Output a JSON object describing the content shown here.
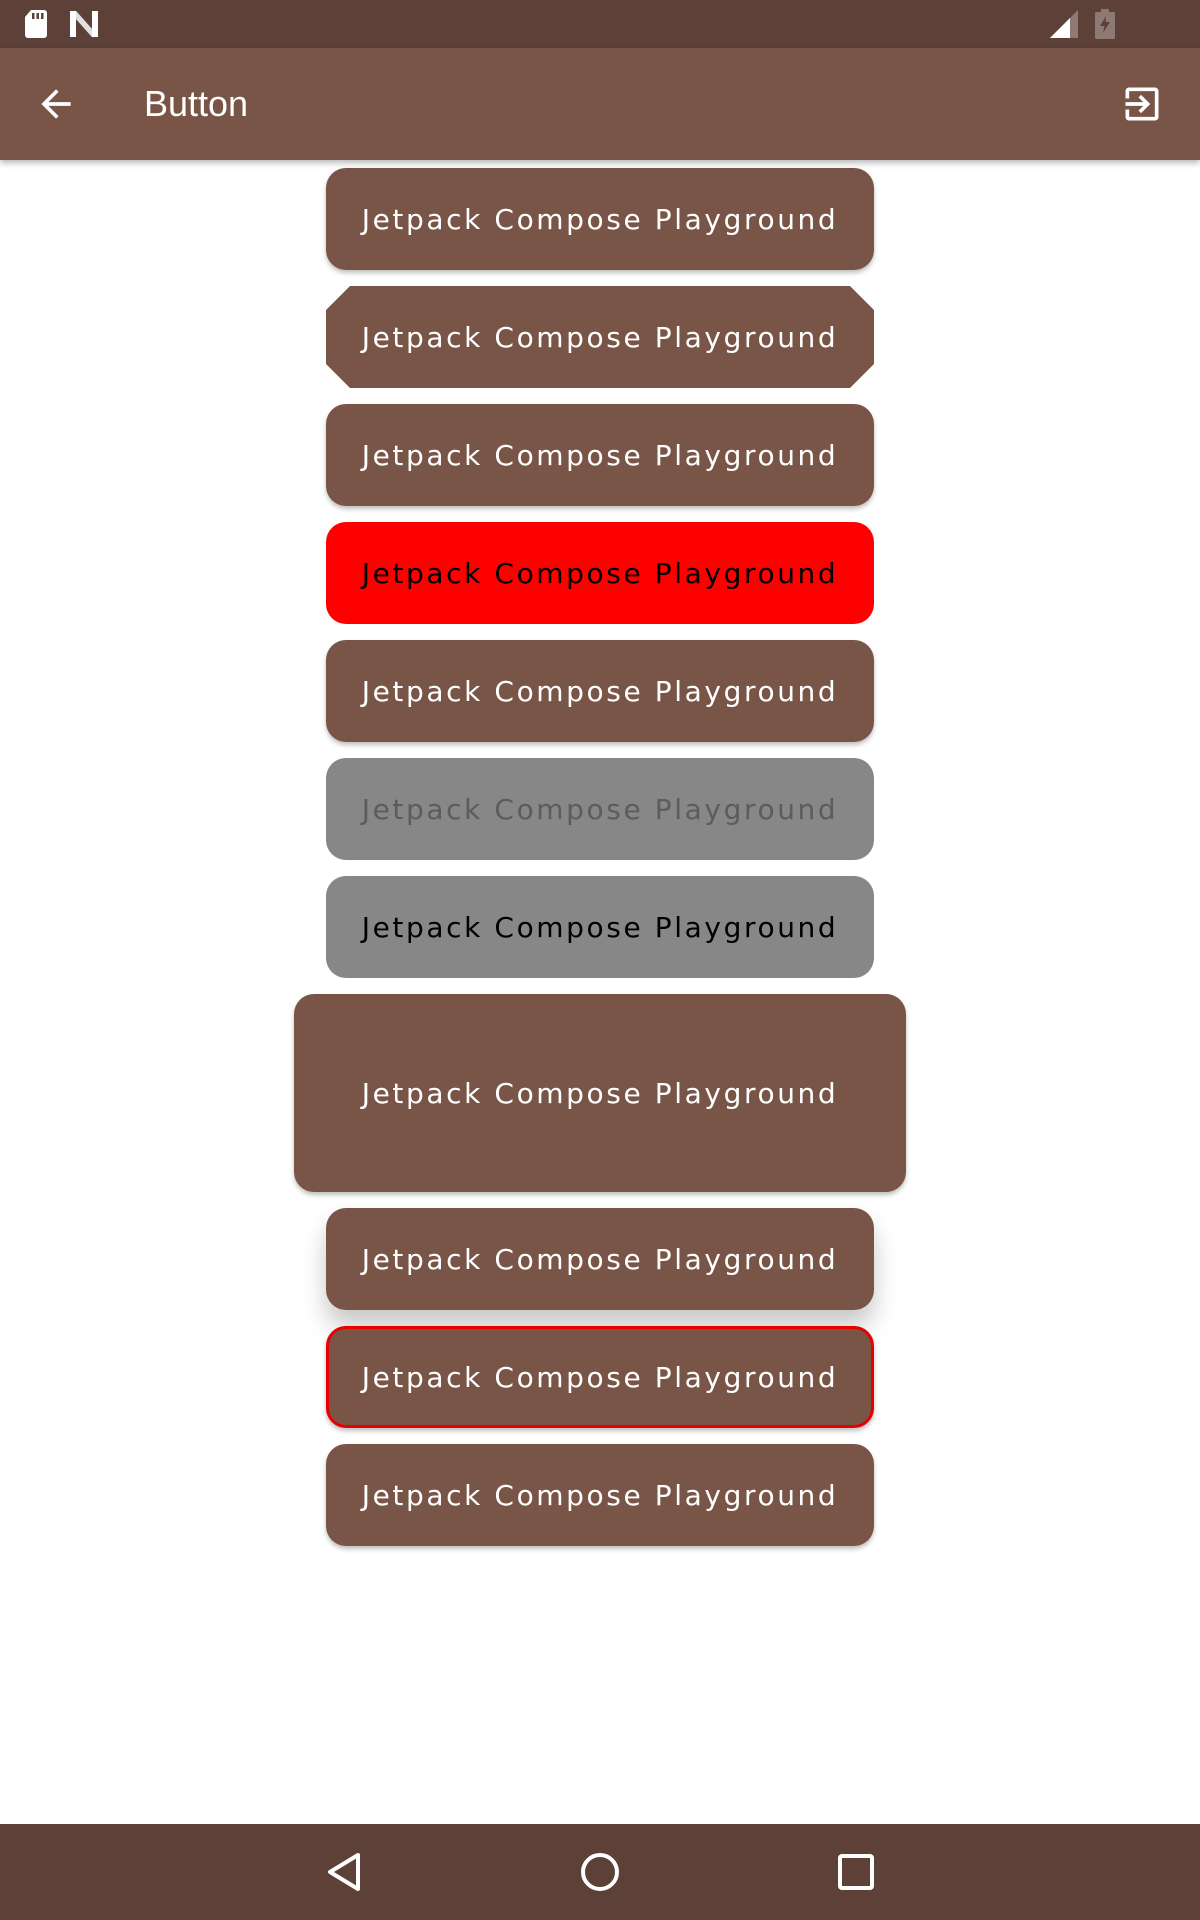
{
  "app_bar": {
    "title": "Button",
    "back_icon": "arrow-back-icon",
    "action_icon": "exit-to-app-icon"
  },
  "colors": {
    "primary": "#795548",
    "primary_dark": "#5d4037",
    "red": "#ff0000",
    "disabled_gray": "#878787"
  },
  "buttons": [
    {
      "label": "Jetpack Compose Playground",
      "style": "rounded"
    },
    {
      "label": "Jetpack Compose Playground",
      "style": "cut-corner"
    },
    {
      "label": "Jetpack Compose Playground",
      "style": "rounded"
    },
    {
      "label": "Jetpack Compose Playground",
      "style": "red-background"
    },
    {
      "label": "Jetpack Compose Playground",
      "style": "rounded"
    },
    {
      "label": "Jetpack Compose Playground",
      "style": "disabled"
    },
    {
      "label": "Jetpack Compose Playground",
      "style": "gray-background"
    },
    {
      "label": "Jetpack Compose Playground",
      "style": "large-padding"
    },
    {
      "label": "Jetpack Compose Playground",
      "style": "elevated"
    },
    {
      "label": "Jetpack Compose Playground",
      "style": "red-border"
    },
    {
      "label": "Jetpack Compose Playground",
      "style": "rounded"
    }
  ],
  "status_bar": {
    "icons": [
      "sd-card-icon",
      "n-logo-icon",
      "cell-signal-icon",
      "battery-charging-icon"
    ]
  },
  "nav_bar": {
    "icons": [
      "nav-back-icon",
      "nav-home-icon",
      "nav-recents-icon"
    ]
  }
}
